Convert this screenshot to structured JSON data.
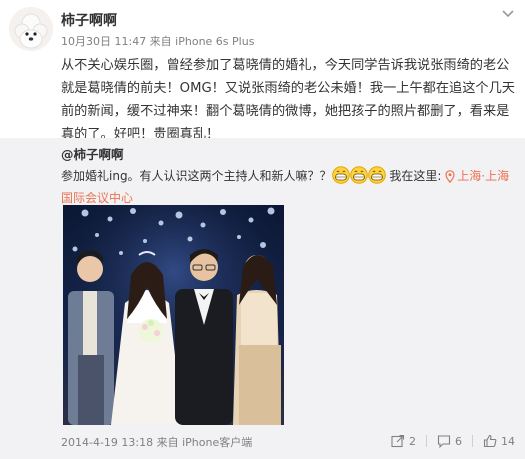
{
  "post": {
    "author": "柿子啊啊",
    "meta": "10月30日 11:47 来自 iPhone 6s Plus",
    "text": "从不关心娱乐圈，曾经参加了葛晓倩的婚礼，今天同学告诉我说张雨绮的老公就是葛晓倩的前夫！OMG！又说张雨绮的老公未婚！我一上午都在追这个几天前的新闻，缓不过神来！翻个葛晓倩的微博，她把孩子的照片都删了，看来是真的了。好吧！贵圈真乱！"
  },
  "repost": {
    "author": "@柿子啊啊",
    "text_before": "参加婚礼ing。有人认识这两个主持人和新人嘛？？",
    "text_after": " 我在这里: ",
    "location": "上海·上海国际会议中心",
    "timestamp": "2014-4-19 13:18 来自 iPhone客户端",
    "actions": {
      "forward_count": "2",
      "comment_count": "6",
      "like_count": "14"
    },
    "icons": {
      "emoji": "grin-emoji-icon",
      "location": "location-pin-icon"
    }
  },
  "colors": {
    "accent": "#eb7350",
    "repost_bg": "#f2f2f5",
    "meta": "#808080"
  }
}
